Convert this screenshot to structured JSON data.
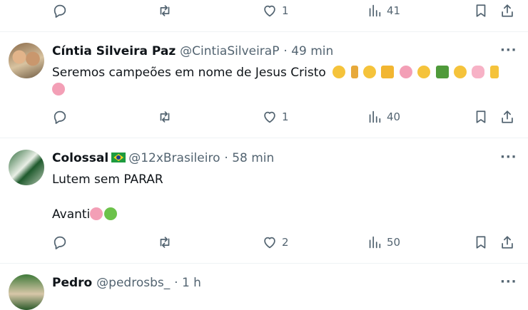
{
  "top_actions": {
    "reply_count": "",
    "repost_count": "",
    "like_count": "1",
    "views_count": "41"
  },
  "tweets": [
    {
      "display_name": "Cíntia Silveira Paz",
      "handle": "@CintiaSilveiraP",
      "time": "· 49 min",
      "text_line_1": "Seremos campeões em nome de Jesus Cristo",
      "emoji_line_1": [
        "pray",
        "medal",
        "raised-hands",
        "trophy",
        "pig-face",
        "clap",
        "palm-tree",
        "muscle",
        "pig",
        "victory"
      ],
      "emoji_line_2": [
        "pig-nose"
      ],
      "actions": {
        "reply_count": "",
        "repost_count": "",
        "like_count": "1",
        "views_count": "40"
      }
    },
    {
      "display_name": "Colossal",
      "handle": "@12xBrasileiro",
      "time": "· 58 min",
      "badge": "brazil-flag",
      "text_line_1": "Lutem sem PARAR",
      "text_line_2": "Avanti",
      "emoji_line_2": [
        "pig-face",
        "green-heart"
      ],
      "actions": {
        "reply_count": "",
        "repost_count": "",
        "like_count": "2",
        "views_count": "50"
      }
    },
    {
      "display_name": "Pedro",
      "handle": "@pedrosbs_",
      "time": "· 1 h"
    }
  ],
  "colors": {
    "text": "#0f1419",
    "secondary": "#536471",
    "divider": "#eff3f4",
    "accent": "#1d9bf0"
  }
}
